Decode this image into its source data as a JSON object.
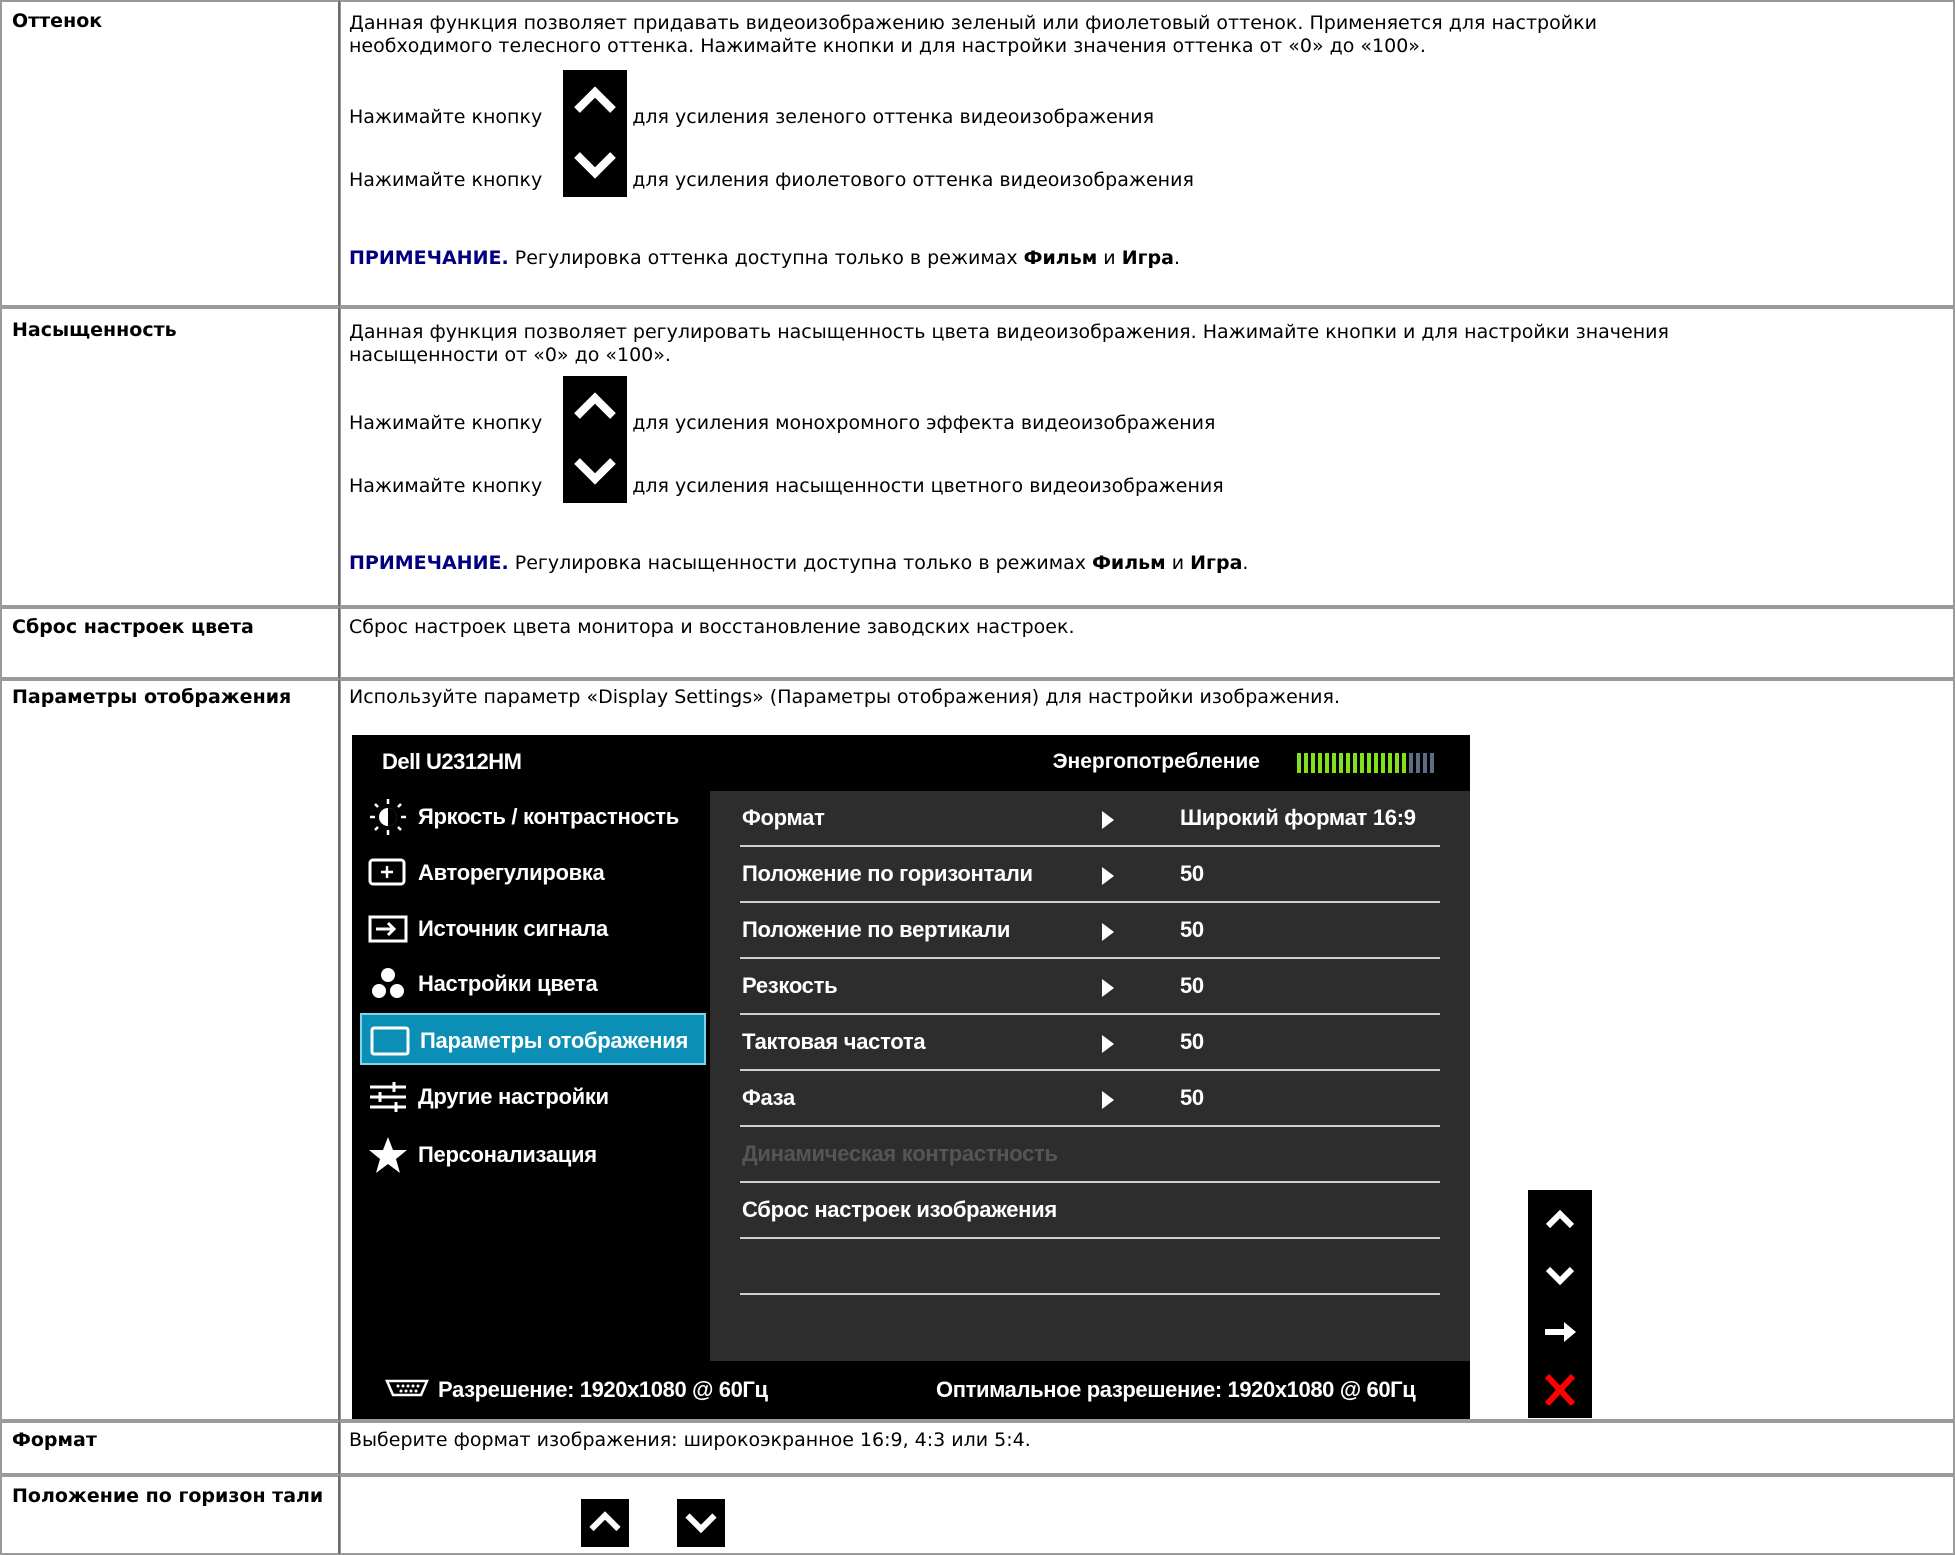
{
  "rows": {
    "hue": {
      "label": "Оттенок",
      "desc_line1": "Данная функция позволяет придавать видеоизображению зеленый или фиолетовый оттенок. Применяется для настройки",
      "desc_line2": "необходимого телесного оттенка. Нажимайте кнопки и для настройки значения оттенка от «0» до «100».",
      "press": "Нажимайте кнопку",
      "up_text": "для усиления зеленого оттенка видеоизображения",
      "down_text": "для усиления фиолетового оттенка видеоизображения",
      "note_label": "ПРИМЕЧАНИЕ.",
      "note_text": "Регулировка оттенка доступна только в режимах",
      "mode1": "Фильм",
      "and": "и",
      "mode2": "Игра",
      "dot": "."
    },
    "saturation": {
      "label": "Насыщенность",
      "desc_line1": "Данная функция позволяет регулировать насыщенность цвета видеоизображения. Нажимайте кнопки и для настройки значения",
      "desc_line2": "насыщенности от «0» до «100».",
      "press": "Нажимайте кнопку",
      "up_text": "для усиления монохромного эффекта видеоизображения",
      "down_text": "для усиления насыщенности цветного видеоизображения",
      "note_label": "ПРИМЕЧАНИЕ.",
      "note_text": "Регулировка насыщенности доступна только в режимах",
      "mode1": "Фильм",
      "and": "и",
      "mode2": "Игра",
      "dot": "."
    },
    "color_reset": {
      "label": "Сброс настроек цвета",
      "desc": "Сброс настроек цвета монитора и восстановление заводских настроек."
    },
    "display_settings": {
      "label": "Параметры отображения",
      "desc": "Используйте параметр «Display Settings» (Параметры отображения) для настройки изображения."
    },
    "aspect": {
      "label": "Формат",
      "desc": "Выберите формат изображения: широкоэкранное 16:9, 4:3 или 5:4."
    },
    "hpos": {
      "label": "Положение по горизон тали"
    }
  },
  "osd": {
    "title": "Dell U2312HM",
    "power_label": "Энергопотребление",
    "power_level": 0.8,
    "menu": [
      {
        "label": "Яркость / контрастность",
        "icon": "brightness-icon"
      },
      {
        "label": "Авторегулировка",
        "icon": "auto-adjust-icon"
      },
      {
        "label": "Источник сигнала",
        "icon": "input-source-icon"
      },
      {
        "label": "Настройки цвета",
        "icon": "color-settings-icon"
      },
      {
        "label": "Параметры отображения",
        "icon": "display-settings-icon"
      },
      {
        "label": "Другие настройки",
        "icon": "other-settings-icon"
      },
      {
        "label": "Персонализация",
        "icon": "star-icon"
      }
    ],
    "selected_menu": 4,
    "items": [
      {
        "label": "Формат",
        "value": "Широкий формат 16:9",
        "arrow": true
      },
      {
        "label": "Положение по горизонтали",
        "value": "50",
        "arrow": true
      },
      {
        "label": "Положение по вертикали",
        "value": "50",
        "arrow": true
      },
      {
        "label": "Резкость",
        "value": "50",
        "arrow": true
      },
      {
        "label": "Тактовая частота",
        "value": "50",
        "arrow": true
      },
      {
        "label": "Фаза",
        "value": "50",
        "arrow": true
      },
      {
        "label": "Динамическая контрастность",
        "value": "",
        "arrow": false,
        "disabled": true
      },
      {
        "label": "Сброс настроек изображения",
        "value": "",
        "arrow": false
      },
      {
        "label": "",
        "value": "",
        "arrow": false
      }
    ],
    "resolution": "Разрешение: 1920x1080 @ 60Гц",
    "optimal": "Оптимальное разрешение: 1920x1080 @ 60Гц",
    "side_buttons": [
      "up-arrow-icon",
      "down-arrow-icon",
      "right-arrow-icon",
      "close-icon"
    ]
  },
  "colors": {
    "note": "#000080",
    "osd_selected": "#0b8fb6",
    "power_on": "#7fe21b",
    "power_off": "#5b6e86",
    "close": "#ff0000"
  }
}
